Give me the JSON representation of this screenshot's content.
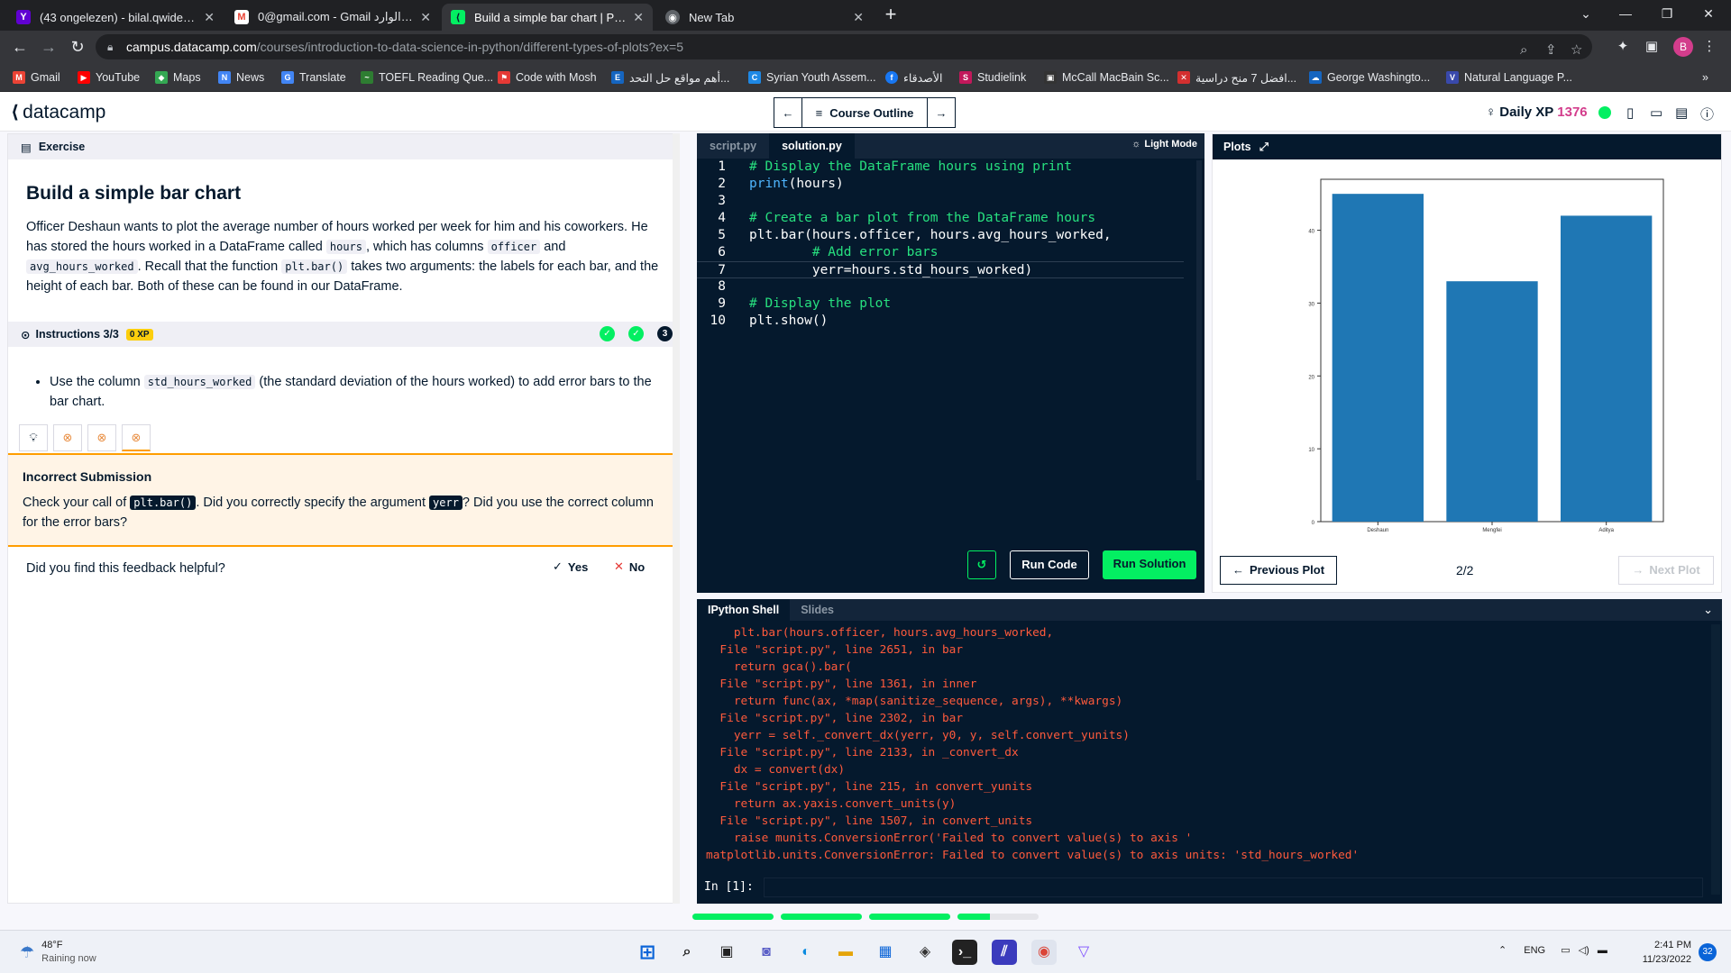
{
  "browser": {
    "tabs": [
      {
        "title": "(43 ongelezen) - bilal.qwider@ya",
        "icon": "yahoo-mail-icon",
        "color": "#6001d2"
      },
      {
        "title": "0@gmail.com - Gmail البريد الوارد",
        "icon": "gmail-icon",
        "color": "#ea4335"
      },
      {
        "title": "Build a simple bar chart | Python",
        "icon": "datacamp-favicon",
        "color": "#03ef62"
      },
      {
        "title": "New Tab",
        "icon": "chrome-newtab-icon",
        "color": "#e8eaed"
      }
    ],
    "url_host": "campus.datacamp.com",
    "url_path": "/courses/introduction-to-data-science-in-python/different-types-of-plots?ex=5",
    "avatar_letter": "B",
    "bookmarks": [
      {
        "label": "Gmail",
        "icon": "gmail-icon",
        "color": "#ea4335"
      },
      {
        "label": "YouTube",
        "icon": "youtube-icon",
        "color": "#ff0000"
      },
      {
        "label": "Maps",
        "icon": "maps-icon",
        "color": "#34a853"
      },
      {
        "label": "News",
        "icon": "news-icon",
        "color": "#4285f4"
      },
      {
        "label": "Translate",
        "icon": "translate-icon",
        "color": "#4285f4"
      },
      {
        "label": "TOEFL Reading Que...",
        "icon": "toefl-icon",
        "color": "#2e7d32"
      },
      {
        "label": "Code with Mosh",
        "icon": "mosh-icon",
        "color": "#e53935"
      },
      {
        "label": "أهم مواقع حل التحد...",
        "icon": "e-icon",
        "color": "#1565c0"
      },
      {
        "label": "Syrian Youth Assem...",
        "icon": "c-icon",
        "color": "#1e88e5"
      },
      {
        "label": "الأصدقاء",
        "icon": "facebook-icon",
        "color": "#1877f2"
      },
      {
        "label": "Studielink",
        "icon": "studielink-icon",
        "color": "#c2185b"
      },
      {
        "label": "McCall MacBain Sc...",
        "icon": "mccall-icon",
        "color": "#333333"
      },
      {
        "label": "افضل 7 منح دراسية...",
        "icon": "x-icon",
        "color": "#d32f2f"
      },
      {
        "label": "George Washingto...",
        "icon": "gw-icon",
        "color": "#1565c0"
      },
      {
        "label": "Natural Language P...",
        "icon": "v-icon",
        "color": "#3949ab"
      }
    ]
  },
  "header": {
    "logo": "datacamp",
    "course_outline": "Course Outline",
    "daily_xp_label": "Daily XP",
    "daily_xp_value": "1376"
  },
  "exercise": {
    "section_label": "Exercise",
    "title": "Build a simple bar chart",
    "body_1": "Officer Deshaun wants to plot the average number of hours worked per week for him and his coworkers. He has stored the hours worked in a DataFrame called ",
    "code_hours": "hours",
    "body_2": ", which has columns ",
    "code_officer": "officer",
    "body_3": " and ",
    "code_avg": "avg_hours_worked",
    "body_4": ". Recall that the function ",
    "code_pltbar": "plt.bar()",
    "body_5": " takes two arguments: the labels for each bar, and the height of each bar. Both of these can be found in our DataFrame.",
    "instructions_label": "Instructions 3/3",
    "xp_badge": "0 XP",
    "step_3": "3",
    "instr_1": "Use the column ",
    "instr_code": "std_hours_worked",
    "instr_2": " (the standard deviation of the hours worked) to add error bars to the bar chart.",
    "feedback_title": "Incorrect Submission",
    "fb_1": "Check your call of ",
    "fb_code1": "plt.bar()",
    "fb_2": ". Did you correctly specify the argument ",
    "fb_code2": "yerr",
    "fb_3": "? Did you use the correct column for the error bars?",
    "helpful_q": "Did you find this feedback helpful?",
    "yes": "Yes",
    "no": "No"
  },
  "editor": {
    "tabs": [
      "script.py",
      "solution.py"
    ],
    "light_mode": "Light Mode",
    "lines": [
      {
        "n": "1",
        "parts": [
          {
            "t": "# Display the DataFrame hours using print",
            "c": "com"
          }
        ]
      },
      {
        "n": "2",
        "parts": [
          {
            "t": "print",
            "c": "kw"
          },
          {
            "t": "(hours)",
            "c": "txt"
          }
        ]
      },
      {
        "n": "3",
        "parts": []
      },
      {
        "n": "4",
        "parts": [
          {
            "t": "# Create a bar plot from the DataFrame hours",
            "c": "com"
          }
        ]
      },
      {
        "n": "5",
        "parts": [
          {
            "t": "plt.bar(hours.officer, hours.avg_hours_worked,",
            "c": "txt"
          }
        ]
      },
      {
        "n": "6",
        "parts": [
          {
            "t": "        ",
            "c": "txt"
          },
          {
            "t": "# Add error bars",
            "c": "com"
          }
        ]
      },
      {
        "n": "7",
        "parts": [
          {
            "t": "        yerr=hours.std_hours_worked)",
            "c": "txt"
          }
        ]
      },
      {
        "n": "8",
        "parts": []
      },
      {
        "n": "9",
        "parts": [
          {
            "t": "# Display the plot",
            "c": "com"
          }
        ]
      },
      {
        "n": "10",
        "parts": [
          {
            "t": "plt.show()",
            "c": "txt"
          }
        ]
      }
    ],
    "run_code": "Run Code",
    "run_solution": "Run Solution"
  },
  "plots": {
    "tab_label": "Plots",
    "prev": "Previous Plot",
    "next": "Next Plot",
    "count": "2/2"
  },
  "chart_data": {
    "type": "bar",
    "categories": [
      "Deshaun",
      "Mengfei",
      "Aditya"
    ],
    "values": [
      45,
      33,
      42
    ],
    "ylim": [
      0,
      47
    ],
    "yticks": [
      "0",
      "10",
      "20",
      "30",
      "40"
    ],
    "bar_color": "#1f77b4",
    "grid": false
  },
  "console": {
    "tabs": [
      "IPython Shell",
      "Slides"
    ],
    "lines": [
      "    plt.bar(hours.officer, hours.avg_hours_worked,",
      "  File \"script.py\", line 2651, in bar",
      "    return gca().bar(",
      "  File \"script.py\", line 1361, in inner",
      "    return func(ax, *map(sanitize_sequence, args), **kwargs)",
      "  File \"script.py\", line 2302, in bar",
      "    yerr = self._convert_dx(yerr, y0, y, self.convert_yunits)",
      "  File \"script.py\", line 2133, in _convert_dx",
      "    dx = convert(dx)",
      "  File \"script.py\", line 215, in convert_yunits",
      "    return ax.yaxis.convert_units(y)",
      "  File \"script.py\", line 1507, in convert_units",
      "    raise munits.ConversionError('Failed to convert value(s) to axis '",
      "matplotlib.units.ConversionError: Failed to convert value(s) to axis units: 'std_hours_worked'"
    ],
    "prompt": "In [1]:"
  },
  "taskbar": {
    "temp": "48°F",
    "weather": "Raining now",
    "lang": "ENG",
    "time": "2:41 PM",
    "date": "11/23/2022",
    "notifications": "32"
  }
}
